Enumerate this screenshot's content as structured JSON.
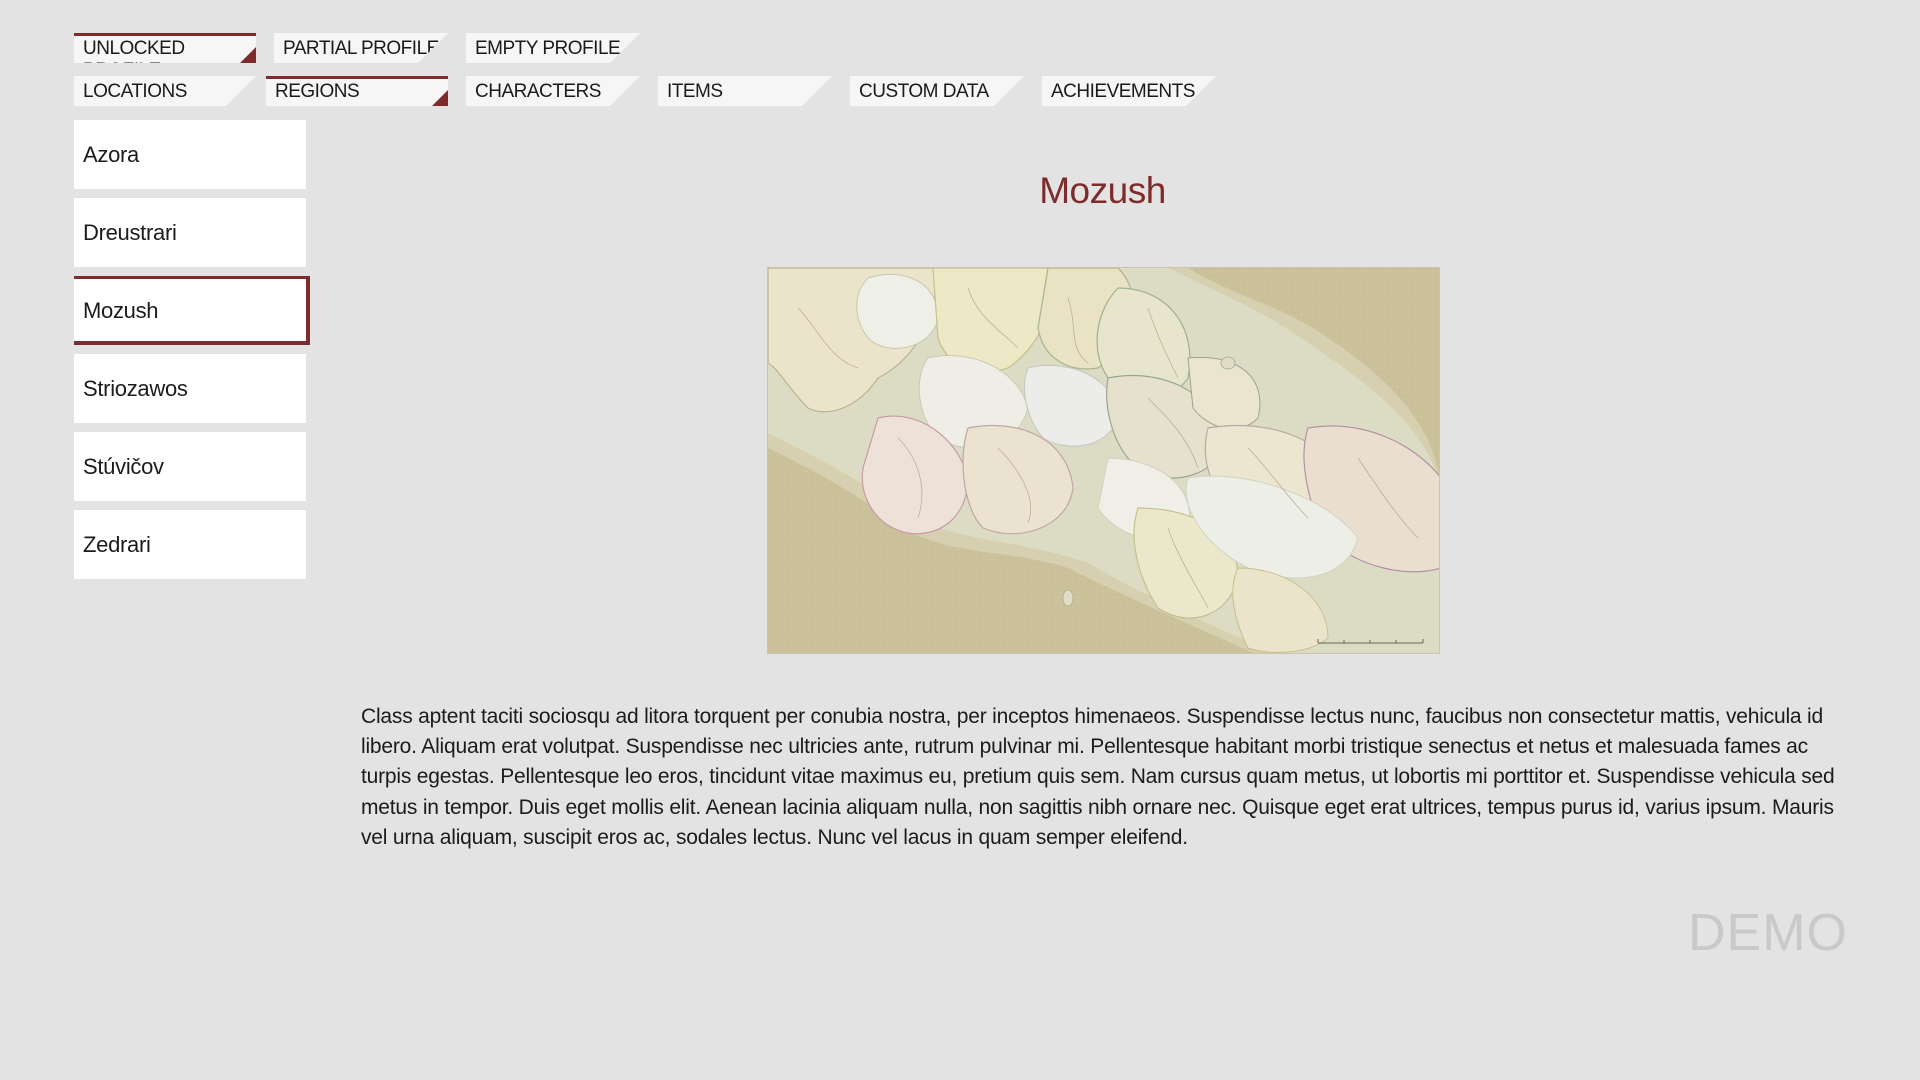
{
  "profile_tabs": [
    {
      "label": "UNLOCKED PROFILE",
      "active": true
    },
    {
      "label": "PARTIAL PROFILE",
      "active": false
    },
    {
      "label": "EMPTY PROFILE",
      "active": false
    }
  ],
  "section_tabs": [
    {
      "label": "LOCATIONS",
      "active": false
    },
    {
      "label": "REGIONS",
      "active": true
    },
    {
      "label": "CHARACTERS",
      "active": false
    },
    {
      "label": "ITEMS",
      "active": false
    },
    {
      "label": "CUSTOM DATA",
      "active": false
    },
    {
      "label": "ACHIEVEMENTS",
      "active": false
    }
  ],
  "regions": [
    {
      "label": "Azora",
      "active": false
    },
    {
      "label": "Dreustrari",
      "active": false
    },
    {
      "label": "Mozush",
      "active": true
    },
    {
      "label": "Striozawos",
      "active": false
    },
    {
      "label": "Stúvičov",
      "active": false
    },
    {
      "label": "Zedrari",
      "active": false
    }
  ],
  "detail": {
    "title": "Mozush",
    "map_icon": "region-map-image",
    "description": "Class aptent taciti sociosqu ad litora torquent per conubia nostra, per inceptos himenaeos. Suspendisse lectus nunc, faucibus non consectetur mattis, vehicula id libero. Aliquam erat volutpat. Suspendisse nec ultricies ante, rutrum pulvinar mi. Pellentesque habitant morbi tristique senectus et netus et malesuada fames ac turpis egestas. Pellentesque leo eros, tincidunt vitae maximus eu, pretium quis sem. Nam cursus quam metus, ut lobortis mi porttitor et. Suspendisse vehicula sed metus in tempor. Duis eget mollis elit. Aenean lacinia aliquam nulla, non sagittis nibh ornare nec. Quisque eget erat ultrices, tempus purus id, varius ipsum. Mauris vel urna aliquam, suscipit eros ac, sodales lectus. Nunc vel lacus in quam semper eleifend."
  },
  "watermark": "DEMO",
  "colors": {
    "accent": "#7d2b2b",
    "background": "#e3e3e3",
    "panel": "#ffffff"
  }
}
